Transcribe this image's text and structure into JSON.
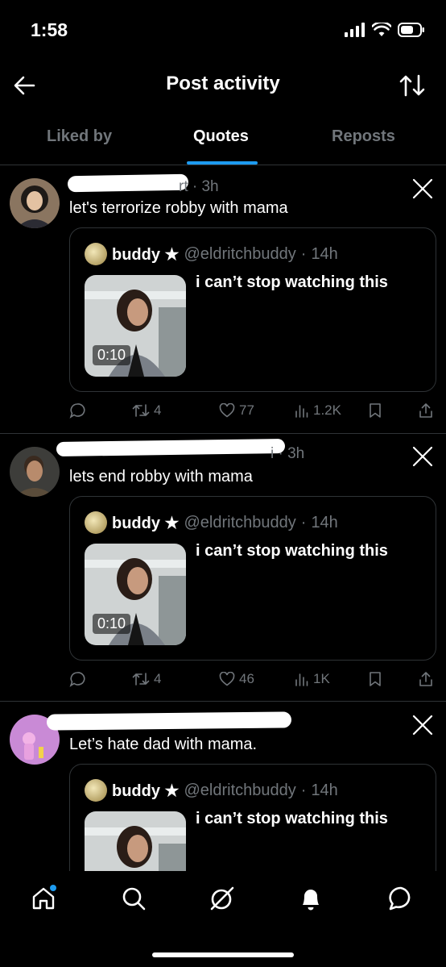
{
  "status": {
    "time": "1:58"
  },
  "header": {
    "title": "Post activity"
  },
  "tabs": [
    {
      "label": "Liked by",
      "active": false
    },
    {
      "label": "Quotes",
      "active": true
    },
    {
      "label": "Reposts",
      "active": false
    }
  ],
  "quoted_post": {
    "name": "buddy ★",
    "handle": "@eldritchbuddy",
    "time": "14h",
    "text": "i can’t stop watching this",
    "duration": "0:10"
  },
  "posts": [
    {
      "meta_tail": "rt · 3h",
      "text": "let's terrorize robby with mama",
      "replies": "",
      "reposts": "4",
      "likes": "77",
      "views": "1.2K"
    },
    {
      "meta_tail": "i · 3h",
      "text": "lets end robby with mama",
      "replies": "",
      "reposts": "4",
      "likes": "46",
      "views": "1K"
    },
    {
      "meta_tail": "",
      "text": "Let’s hate dad with mama."
    }
  ],
  "colors": {
    "accent": "#1d9bf0",
    "background": "#000000",
    "muted": "#71767b",
    "border": "#2f3336"
  }
}
